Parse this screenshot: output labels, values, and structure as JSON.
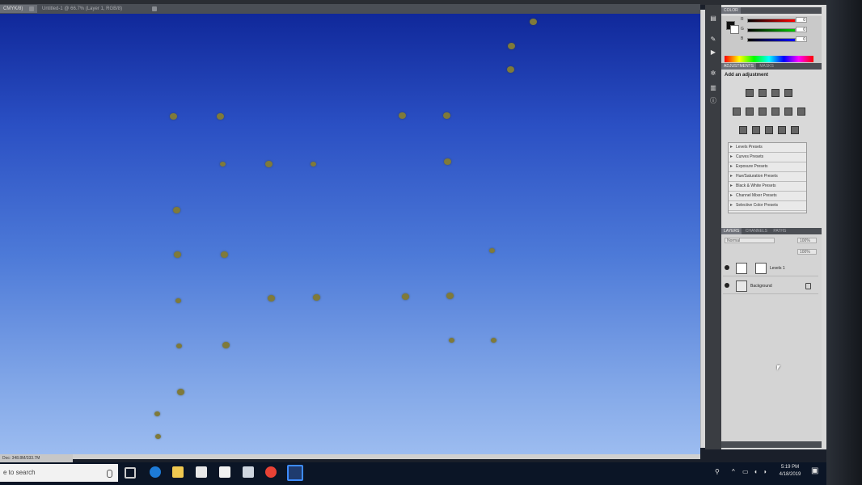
{
  "tabs": [
    {
      "label": "CMYK/8)",
      "active": true
    },
    {
      "label": "Untitled-1 @ 66.7% (Layer 1, RGB/8)",
      "active": false
    }
  ],
  "status_bar": {
    "doc_size": "Doc: 348.8M/333.7M"
  },
  "color_panel": {
    "tab_label": "COLOR",
    "channels": [
      {
        "label": "R",
        "value": "0"
      },
      {
        "label": "G",
        "value": "0"
      },
      {
        "label": "B",
        "value": "0"
      }
    ]
  },
  "adjustments_panel": {
    "tabs": [
      "ADJUSTMENTS",
      "MASKS"
    ],
    "title": "Add an adjustment",
    "presets": [
      "Levels Presets",
      "Curves Presets",
      "Exposure Presets",
      "Hue/Saturation Presets",
      "Black & White Presets",
      "Channel Mixer Presets",
      "Selective Color Presets"
    ]
  },
  "layers_panel": {
    "tabs": [
      "LAYERS",
      "CHANNELS",
      "PATHS"
    ],
    "blend_mode": "Normal",
    "opacity": "100%",
    "fill": "100%",
    "layers": [
      {
        "name": "Levels 1"
      },
      {
        "name": "Background"
      }
    ]
  },
  "taskbar": {
    "search_placeholder": "e to search",
    "clock_time": "5:19 PM",
    "clock_date": "4/18/2019"
  },
  "colors": {
    "canvas_top": "#10289a",
    "canvas_bottom": "#9cbcf0",
    "dot": "#7f7a3a",
    "taskbar": "#0b1526"
  }
}
